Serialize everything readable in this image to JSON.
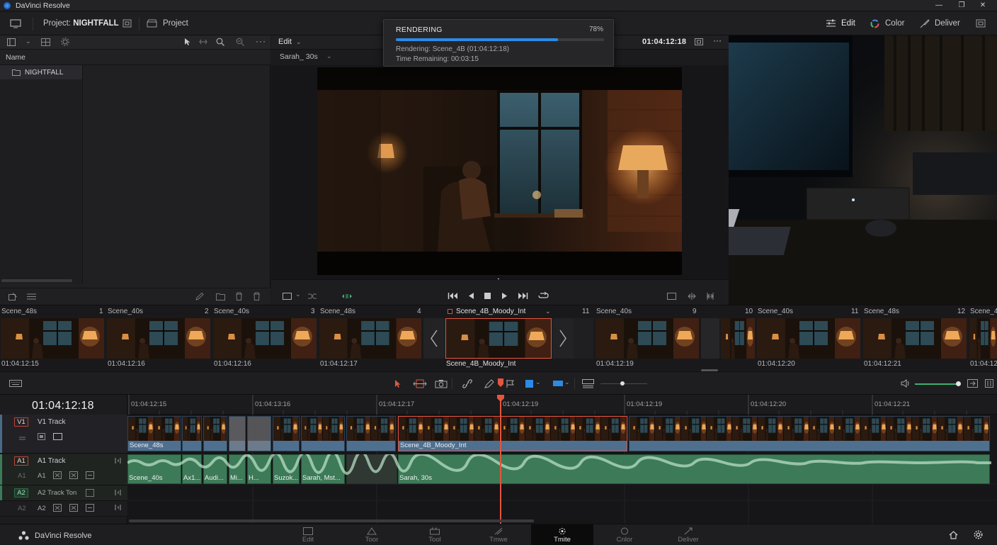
{
  "app": {
    "title": "DaVinci Resolve",
    "brand": "DaVinci Resolve"
  },
  "toolbar": {
    "project_prefix": "Project: ",
    "project_name": "NIGHTFALL",
    "project_link": "Project",
    "pages": {
      "edit": "Edit",
      "color": "Color",
      "deliver": "Deliver"
    }
  },
  "media_pool": {
    "column_name": "Name",
    "bins": [
      "NIGHTFALL"
    ]
  },
  "viewer": {
    "mode": "Edit",
    "clip_name": "Sarah_ 30s",
    "timecode": "01:04:12:18"
  },
  "render": {
    "title": "RENDERING",
    "percent": "78%",
    "progress": 0.78,
    "line1": "Rendering: Scene_4B (01:04:12:18)",
    "line2": "Time Remaining: 00:03:15"
  },
  "clips": [
    {
      "name": "Scene_48s",
      "num": "1",
      "tc": "01:04:12:15"
    },
    {
      "name": "Scene_40s",
      "num": "2",
      "tc": "01:04:12:16"
    },
    {
      "name": "Scene_40s",
      "num": "3",
      "tc": "01:04:12:16"
    },
    {
      "name": "Scene_48s",
      "num": "4",
      "tc": "01:04:12:17"
    },
    {
      "name": "Scene_4B_Moody_Int",
      "num": "",
      "tc": "Scene_4B_Moody_Int"
    },
    {
      "name": "Scene_40s",
      "num": "11",
      "tc": "01:04:12:19"
    },
    {
      "name": "",
      "num": "9",
      "tc": ""
    },
    {
      "name": "Scene_40s",
      "num": "10",
      "tc": "01:04:12:20"
    },
    {
      "name": "Scene_48s",
      "num": "11",
      "tc": "01:04:12:21"
    },
    {
      "name": "Scene_4",
      "num": "12",
      "tc": "01:04:12"
    }
  ],
  "timeline": {
    "timecode": "01:04:12:18",
    "ruler": [
      "01:04:12:15",
      "01:04:13:16",
      "01:04:12:17",
      "01:04:12:19",
      "01:04:12:19",
      "01:04:12:20",
      "01:04:12:21"
    ],
    "tracks": {
      "v1": {
        "tag": "V1",
        "name": "V1 Track"
      },
      "a1": {
        "tag": "A1",
        "name": "A1 Track",
        "sub": "A1"
      },
      "a2": {
        "tag": "A2",
        "name": "A2 Track Ton",
        "sub": "A2"
      },
      "a1_dim": "A1",
      "a2_dim": "A2"
    },
    "video_clips": [
      "Scene_48s",
      "Scene_4B_Moody_Int"
    ],
    "audio_clips": [
      "Scene_40s",
      "Ax1...",
      "Audi...",
      "Mi...",
      "H...",
      "Suzok...",
      "Sarah, Mst...",
      "Sarah, 30s"
    ]
  },
  "bottom_pages": [
    "Edit",
    "Toor",
    "Tool",
    "Tmwe",
    "Tmite",
    "Cnlor",
    "Deliver"
  ],
  "bottom_active": 4,
  "colors": {
    "accent": "#2b8be6",
    "playhead": "#e4553f",
    "video": "#4f6f8f",
    "audio": "#3d7a58"
  }
}
